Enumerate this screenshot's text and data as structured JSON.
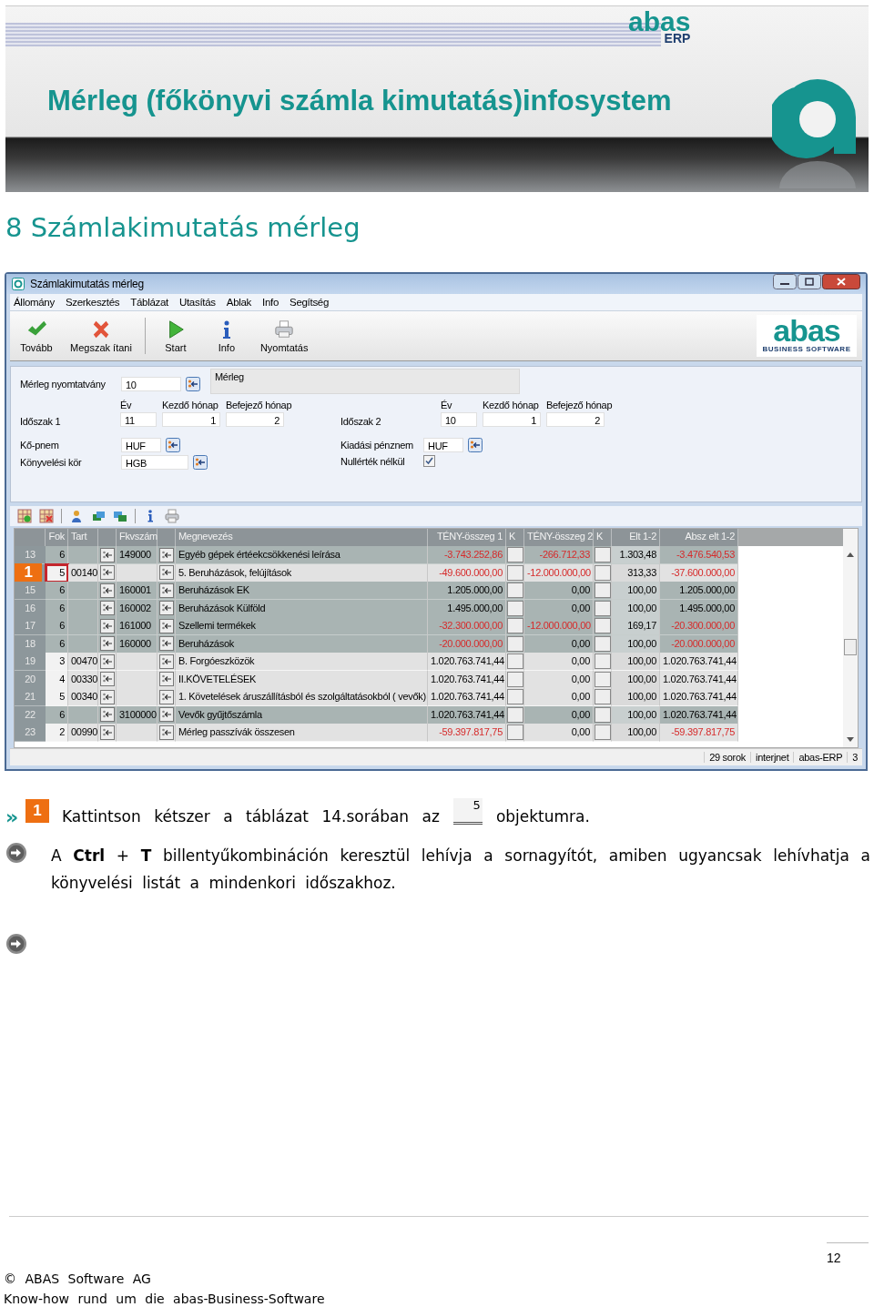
{
  "header": {
    "logo_word": "abas",
    "logo_sub": "ERP",
    "title": "Mérleg (főkönyvi számla kimutatás)infosystem"
  },
  "section_heading": "8 Számlakimutatás mérleg",
  "window": {
    "title": "Számlakimutatás mérleg",
    "menu": [
      "Állomány",
      "Szerkesztés",
      "Táblázat",
      "Utasítás",
      "Ablak",
      "Info",
      "Segítség"
    ],
    "toolbar": [
      {
        "label": "Tovább",
        "kind": "ok"
      },
      {
        "label": "Megszak ítani",
        "kind": "cancel"
      },
      {
        "label": "Start",
        "kind": "start"
      },
      {
        "label": "Info",
        "kind": "info"
      },
      {
        "label": "Nyomtatás",
        "kind": "print"
      }
    ],
    "logo": {
      "word": "abas",
      "sub": "BUSINESS SOFTWARE"
    },
    "form": {
      "print_form": {
        "label": "Mérleg nyomtatvány",
        "value": "10",
        "description": "Mérleg"
      },
      "periods": [
        {
          "label": "Időszak 1",
          "year_label": "Év",
          "start_label": "Kezdő hónap",
          "end_label": "Befejező hónap",
          "year": "11",
          "start": "1",
          "end": "2"
        },
        {
          "label": "Időszak 2",
          "year_label": "Év",
          "start_label": "Kezdő hónap",
          "end_label": "Befejező hónap",
          "year": "10",
          "start": "1",
          "end": "2"
        }
      ],
      "currency": {
        "label": "Kő-pnem",
        "value": "HUF"
      },
      "ledger": {
        "label": "Könyvelési kör",
        "value": "HGB"
      },
      "output_currency": {
        "label": "Kiadási pénznem",
        "value": "HUF"
      },
      "no_zero": {
        "label": "Nullérték nélkül",
        "checked": true
      }
    },
    "table": {
      "columns": {
        "fok": "Fok",
        "tart": "Tart",
        "fkv": "Fkvszám",
        "name": "Megnevezés",
        "act1": "TÉNY-összeg 1",
        "k1": "K",
        "act2": "TÉNY-összeg 2",
        "k2": "K",
        "dev": "Elt 1-2",
        "absdev": "Absz elt 1-2"
      },
      "callout": "1",
      "rows": [
        {
          "num": "13",
          "fok": "6",
          "fkv": "149000",
          "name": "Egyéb gépek értéekcsökkenési leírása",
          "act1": {
            "v": "-3.743.252,86",
            "red": true
          },
          "act2": {
            "v": "-266.712,33",
            "red": true
          },
          "dev": "1.303,48",
          "absdev": {
            "v": "-3.476.540,53",
            "red": true
          },
          "shaded": true,
          "marked": false
        },
        {
          "fok": "5",
          "tart": "00140",
          "name": "5. Beruházások, felújítások",
          "act1": {
            "v": "-49.600.000,00",
            "red": true
          },
          "act2": {
            "v": "-12.000.000,00",
            "red": true
          },
          "dev": "313,33",
          "absdev": {
            "v": "-37.600.000,00",
            "red": true
          },
          "shaded": false,
          "marked": true
        },
        {
          "num": "15",
          "fok": "6",
          "fkv": "160001",
          "name": "Beruházások EK",
          "act1": {
            "v": "1.205.000,00",
            "red": false
          },
          "act2": {
            "v": "0,00",
            "red": false
          },
          "dev": "100,00",
          "absdev": {
            "v": "1.205.000,00",
            "red": false
          },
          "shaded": true,
          "marked": false
        },
        {
          "num": "16",
          "fok": "6",
          "fkv": "160002",
          "name": "Beruházások Külföld",
          "act1": {
            "v": "1.495.000,00",
            "red": false
          },
          "act2": {
            "v": "0,00",
            "red": false
          },
          "dev": "100,00",
          "absdev": {
            "v": "1.495.000,00",
            "red": false
          },
          "shaded": true,
          "marked": false
        },
        {
          "num": "17",
          "fok": "6",
          "fkv": "161000",
          "name": "Szellemi termékek",
          "act1": {
            "v": "-32.300.000,00",
            "red": true
          },
          "act2": {
            "v": "-12.000.000,00",
            "red": true
          },
          "dev": "169,17",
          "absdev": {
            "v": "-20.300.000,00",
            "red": true
          },
          "shaded": true,
          "marked": false
        },
        {
          "num": "18",
          "fok": "6",
          "fkv": "160000",
          "name": "Beruházások",
          "act1": {
            "v": "-20.000.000,00",
            "red": true
          },
          "act2": {
            "v": "0,00",
            "red": false
          },
          "dev": "100,00",
          "absdev": {
            "v": "-20.000.000,00",
            "red": true
          },
          "shaded": true,
          "marked": false
        },
        {
          "num": "19",
          "fok": "3",
          "tart": "00470",
          "name": "B.    Forgóeszközök",
          "act1": {
            "v": "1.020.763.741,44",
            "red": false
          },
          "act2": {
            "v": "0,00",
            "red": false
          },
          "dev": "100,00",
          "absdev": {
            "v": "1.020.763.741,44",
            "red": false
          },
          "shaded": false,
          "marked": false
        },
        {
          "num": "20",
          "fok": "4",
          "tart": "00330",
          "name": "II.KÖVETELÉSEK",
          "act1": {
            "v": "1.020.763.741,44",
            "red": false
          },
          "act2": {
            "v": "0,00",
            "red": false
          },
          "dev": "100,00",
          "absdev": {
            "v": "1.020.763.741,44",
            "red": false
          },
          "shaded": false,
          "marked": false
        },
        {
          "num": "21",
          "fok": "5",
          "tart": "00340",
          "name": "1. Követelések áruszállításból és szolgáltatásokból ( vevők)",
          "act1": {
            "v": "1.020.763.741,44",
            "red": false
          },
          "act2": {
            "v": "0,00",
            "red": false
          },
          "dev": "100,00",
          "absdev": {
            "v": "1.020.763.741,44",
            "red": false
          },
          "shaded": false,
          "marked": false
        },
        {
          "num": "22",
          "fok": "6",
          "fkv": "3100000",
          "name": "Vevők gyűjtőszámla",
          "act1": {
            "v": "1.020.763.741,44",
            "red": false
          },
          "act2": {
            "v": "0,00",
            "red": false
          },
          "dev": "100,00",
          "absdev": {
            "v": "1.020.763.741,44",
            "red": false
          },
          "shaded": true,
          "marked": false
        },
        {
          "num": "23",
          "fok": "2",
          "tart": "00990",
          "name": "Mérleg passzívák összesen",
          "act1": {
            "v": "-59.397.817,75",
            "red": true
          },
          "act2": {
            "v": "0,00",
            "red": false
          },
          "dev": "100,00",
          "absdev": {
            "v": "-59.397.817,75",
            "red": true
          },
          "shaded": false,
          "marked": false
        }
      ]
    },
    "status_bar": [
      "29 sorok",
      "interjnet",
      "abas-ERP",
      "3"
    ]
  },
  "instructions": [
    {
      "kind": "step",
      "bullet": "»",
      "badge": "1",
      "before": "Kattintson kétszer a táblázat 14.sorában az",
      "cell_value": "5",
      "after": "objektumra."
    },
    {
      "kind": "note",
      "text": "A **Ctrl** + **T** billentyűkombináción keresztül lehívja a sornagyítót, amiben ugyancsak lehívhatja a könyvelési listát a mindenkori időszakhoz."
    },
    {
      "kind": "blank"
    }
  ],
  "footer": {
    "page": "12",
    "copyright": "© ABAS Software AG",
    "tagline": "Know-how rund um die abas-Business-Software"
  }
}
